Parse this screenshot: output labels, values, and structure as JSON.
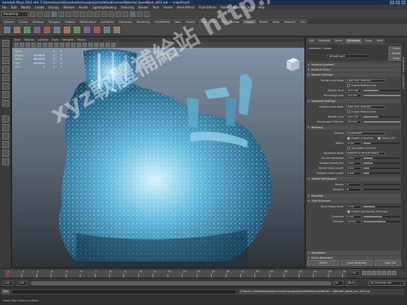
{
  "title_bar": {
    "text": "Autodesk Maya 2012 x64: C:/Users/brooks/Documents/maya/projects/default/scenes/Waterfall_SpeedBoat_v001.mb --- snakeFront1"
  },
  "menu_bar": {
    "items": [
      "File",
      "Edit",
      "Modify",
      "Create",
      "Display",
      "Window",
      "Assets",
      "Lighting/Shading",
      "Texturing",
      "Render",
      "Toon",
      "Stereo",
      "Paint Effects",
      "Fluid Effects",
      "Fields",
      "Pipeline Cache",
      "Help"
    ]
  },
  "status_line": {
    "mode": "Rendering"
  },
  "shelf": {
    "tabs": [
      "General",
      "Curves",
      "Surfaces",
      "Polygons",
      "Subdivs",
      "Deformation",
      "Animation",
      "Dynamics",
      "Rendering",
      "PaintEffects",
      "Toon",
      "Muscle",
      "Fluids",
      "Fur",
      "Hair",
      "nCloth",
      "Custom",
      "Bifrost",
      "Mesh",
      "PowerFX",
      "nCx"
    ],
    "active_tab": "Custom"
  },
  "viewport": {
    "menu": [
      "View",
      "Shading",
      "Lighting",
      "Show",
      "Renderer",
      "Panels"
    ],
    "hud": [
      {
        "label": "Verts:",
        "v1": "...",
        "v2": "0",
        "v3": "0"
      },
      {
        "label": "Edges:",
        "v1": "9849896",
        "v2": "0",
        "v3": "0"
      },
      {
        "label": "Faces:",
        "v1": "9849896",
        "v2": "0",
        "v3": "0"
      },
      {
        "label": "Tris:",
        "v1": "9849896",
        "v2": "0",
        "v3": "0"
      },
      {
        "label": "UVs:",
        "v1": "0",
        "v2": "0",
        "v3": "0"
      }
    ],
    "quality": "High Quality"
  },
  "channel_box": {
    "tabs": [
      "List",
      "Selected",
      "Focus",
      "Attributes",
      "Show",
      "Help"
    ],
    "node_label": "transform / shape",
    "node_name": "bifrostFront1",
    "focus_btn": "Focus",
    "presets_btn": "Presets",
    "show_btn": "Show",
    "hide_btn": "Hide",
    "sections": {
      "particle_systems": "Particle Systems",
      "particle_filters": "Particle Filters",
      "render_settings": "Render Settings",
      "viewport_settings": "Viewport Settings",
      "meshing": "Meshing",
      "vertex_refinement": "Vertex Refinement",
      "pointball": "Pointball",
      "zero_emission": "Zero Emission",
      "metabatto": "MetaBatto",
      "extra_attributes": "Extra Attributes"
    },
    "render": {
      "mode_label": "Render Load Mode",
      "mode_value": "Load Point Particles",
      "enable_limit": "Enable Particle Limit",
      "limit_label": "Particle Limit",
      "limit_value": "1000.000",
      "percentage_label": "Percentage Load",
      "percentage_value": "100.000"
    },
    "viewport": {
      "mode_label": "Viewport Load Mode",
      "mode_value": "Load Point Particles",
      "enable_limit": "Enable Particle Limit",
      "limit_label": "Particle Limit",
      "limit_value": "1000.000",
      "percentage_label": "Percentage Of Render",
      "percentage_value": "100.000"
    },
    "meshing": {
      "method_label": "Method",
      "method_value": "Zhu/Bridson",
      "enable_meshing": "Enable in Renders",
      "show_viewport": "Show in VP",
      "radius_label": "Radius",
      "radius_value": "1.000",
      "use_radius": "Use Radius Channel",
      "resolution_mode_label": "Resolution Mode",
      "resolution_mode_value": "Relative To Particle Radius",
      "render_res_label": "Render Resolution",
      "render_res_value": "1.000",
      "viewport_res_label": "Viewport Resolution",
      "viewport_res_value": "1.000",
      "render_voxel_label": "Render Voxel Length",
      "render_voxel_value": "0.400",
      "viewport_voxel_label": "Viewport Voxel Length",
      "viewport_voxel_value": "0.400"
    },
    "vertex": {
      "render_label": "Render",
      "render_value": "0",
      "viewport_label": "Viewport",
      "viewport_value": "0"
    },
    "zhu": {
      "blend_label": "Blend Radius Scale",
      "blend_value": "1.200",
      "enable_density": "Enable Low Density Trimming",
      "threshold_label": "Threshold",
      "threshold_value": "0.500",
      "strength_label": "Strength",
      "strength_value": "10.000"
    },
    "bottom": [
      "Select",
      "Load Attributes",
      "Copy Tab"
    ]
  },
  "side_strip": "Channel Box / Layer Editor",
  "timeline": {
    "labels": [
      "1",
      "2",
      "3",
      "4",
      "5",
      "6",
      "7",
      "8",
      "9",
      "10",
      "11",
      "12",
      "13",
      "14",
      "15",
      "16",
      "17",
      "18",
      "19",
      "20",
      "21",
      "22",
      "23",
      "24"
    ],
    "current": "1.00",
    "current_frame": 1
  },
  "range": {
    "start": "1.00",
    "inner_start": "1.00",
    "inner_end": "24",
    "end": "48.00",
    "end2": "24.00",
    "character_set": "No Character Set"
  },
  "command_line": {
    "lang": "MEL",
    "output": "// Result: C:/Users/brooks/Documents/maya/projects/default/cache/bifrost/... Waterfall_Speed_sim_v001.mb"
  },
  "help_line": {
    "text": "Select Tool: select an object"
  },
  "watermark": "xyz軟體補給站 http://31.to"
}
